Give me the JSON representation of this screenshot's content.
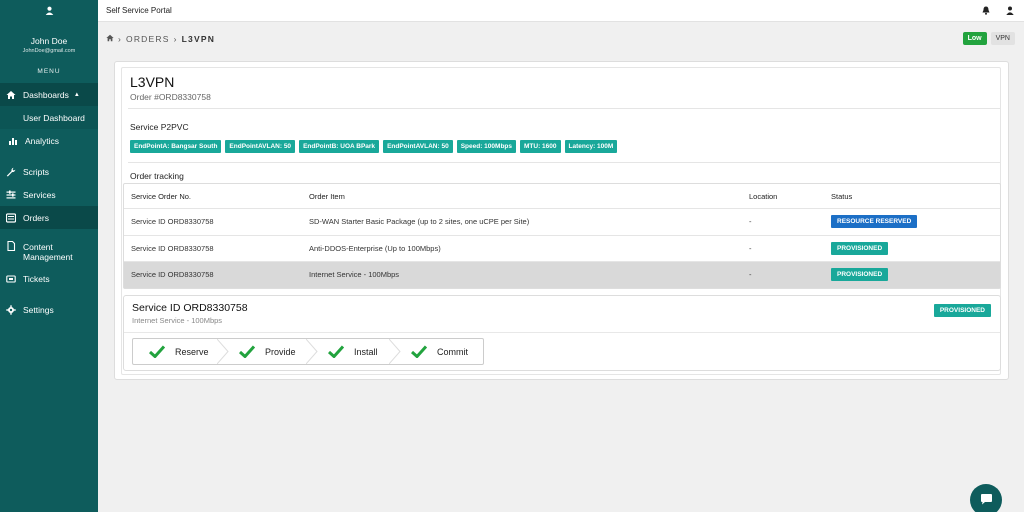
{
  "user": {
    "name": "John Doe",
    "email": "JohnDoe@gmail.com"
  },
  "sidebar": {
    "menu_label": "MENU",
    "items": [
      {
        "label": "Dashboards",
        "icon": "home-icon"
      },
      {
        "label": "User Dashboard",
        "icon": ""
      },
      {
        "label": "Analytics",
        "icon": "bar-chart-icon"
      },
      {
        "label": "Scripts",
        "icon": "wrench-icon"
      },
      {
        "label": "Services",
        "icon": "sliders-icon"
      },
      {
        "label": "Orders",
        "icon": "list-icon"
      },
      {
        "label": "Content Management",
        "icon": "file-icon"
      },
      {
        "label": "Tickets",
        "icon": "ticket-icon"
      },
      {
        "label": "Settings",
        "icon": "gear-icon"
      }
    ]
  },
  "topbar": {
    "title": "Self Service Portal"
  },
  "breadcrumb": {
    "part1": "ORDERS",
    "part2": "L3VPN"
  },
  "pills": {
    "low": "Low",
    "vpn": "VPN"
  },
  "order": {
    "title": "L3VPN",
    "number": "Order #ORD8330758",
    "p2pvc_label": "Service P2PVC",
    "tags": [
      "EndPointA: Bangsar South",
      "EndPointAVLAN: 50",
      "EndPointB: UOA BPark",
      "EndPointAVLAN: 50",
      "Speed: 100Mbps",
      "MTU: 1600",
      "Latency: 100M"
    ],
    "tracking_label": "Order tracking"
  },
  "table": {
    "headers": [
      "Service Order No.",
      "Order Item",
      "Location",
      "Status"
    ],
    "rows": [
      {
        "order_no": "Service ID ORD8330758",
        "item": "SD-WAN Starter Basic Package (up to 2 sites, one uCPE per Site)",
        "location": "-",
        "status": "RESOURCE RESERVED"
      },
      {
        "order_no": "Service ID ORD8330758",
        "item": "Anti-DDOS-Enterprise (Up to 100Mbps)",
        "location": "-",
        "status": "PROVISIONED"
      },
      {
        "order_no": "Service ID ORD8330758",
        "item": "Internet Service - 100Mbps",
        "location": "-",
        "status": "PROVISIONED"
      }
    ]
  },
  "detail": {
    "title": "Service ID ORD8330758",
    "subtitle": "Internet Service - 100Mbps",
    "status": "PROVISIONED",
    "steps": [
      "Reserve",
      "Provide",
      "Install",
      "Commit"
    ]
  },
  "colors": {
    "sidebar": "#0e5c5c",
    "accent": "#19a89a",
    "blue_badge": "#1c6fc6",
    "low_pill": "#22a33e",
    "check": "#22a33e"
  }
}
